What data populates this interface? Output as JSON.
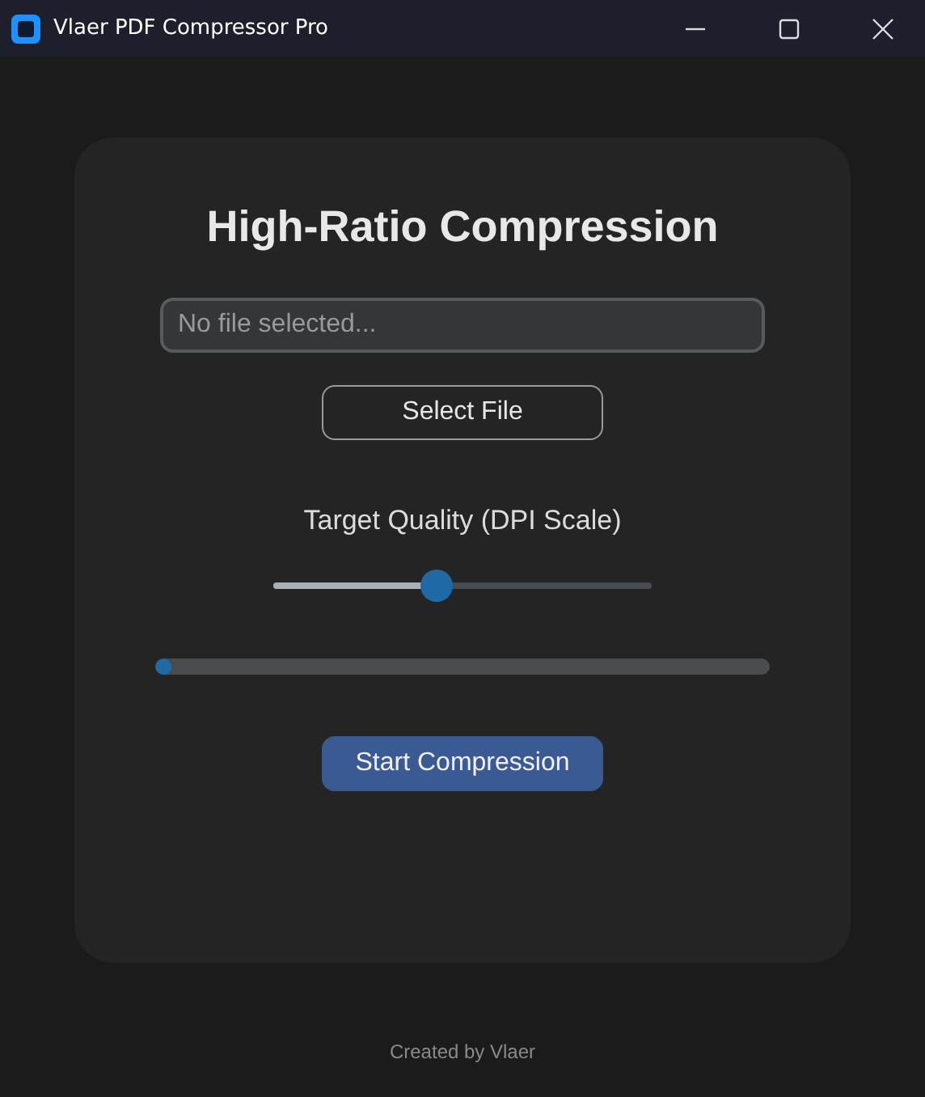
{
  "window": {
    "title": "Vlaer PDF Compressor Pro"
  },
  "card": {
    "title": "High-Ratio Compression",
    "file_field": {
      "placeholder": "No file selected..."
    },
    "select_button": "Select File",
    "quality": {
      "label": "Target Quality (DPI Scale)",
      "level": 0.43
    },
    "progress": {
      "level": 0.02
    },
    "start_button": "Start Compression"
  },
  "footer": "Created by Vlaer"
}
